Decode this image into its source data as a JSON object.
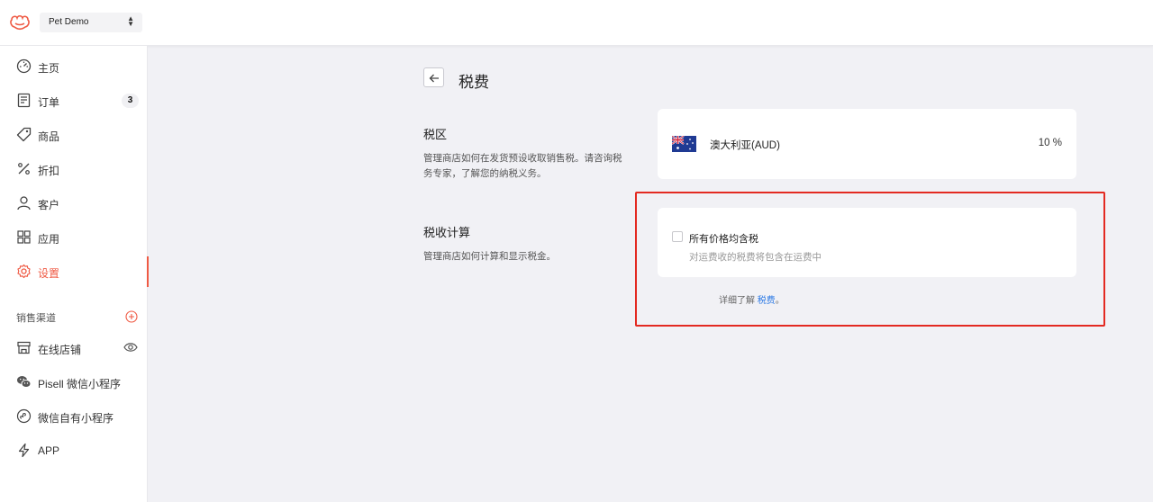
{
  "header": {
    "store_name": "Pet Demo"
  },
  "sidebar": {
    "items": [
      {
        "label": "主页",
        "icon": "dashboard-icon"
      },
      {
        "label": "订单",
        "icon": "order-icon",
        "badge": "3"
      },
      {
        "label": "商品",
        "icon": "tag-icon"
      },
      {
        "label": "折扣",
        "icon": "percent-icon"
      },
      {
        "label": "客户",
        "icon": "user-icon"
      },
      {
        "label": "应用",
        "icon": "apps-icon"
      },
      {
        "label": "设置",
        "icon": "gear-icon",
        "active": true
      }
    ],
    "channels_title": "销售渠道",
    "channels": [
      {
        "label": "在线店铺",
        "icon": "store-icon"
      },
      {
        "label": "Pisell 微信小程序",
        "icon": "wechat-icon"
      },
      {
        "label": "微信自有小程序",
        "icon": "miniprogram-icon"
      },
      {
        "label": "APP",
        "icon": "lightning-icon"
      }
    ]
  },
  "main": {
    "page_title": "税费",
    "tax_region": {
      "heading": "税区",
      "description": "管理商店如何在发货预设收取销售税。请咨询税务专家，了解您的纳税义务。",
      "region_name": "澳大利亚(AUD)",
      "rate": "10 %"
    },
    "tax_calc": {
      "heading": "税收计算",
      "description": "管理商店如何计算和显示税金。",
      "checkbox_label": "所有价格均含税",
      "checkbox_hint": "对运费收的税费将包含在运费中",
      "checked": false
    },
    "learn_more_prefix": "详细了解",
    "learn_more_link": "税费",
    "learn_more_suffix": "。"
  },
  "colors": {
    "accent": "#ef5a44",
    "link": "#2f7be5",
    "highlight": "#e32a21"
  }
}
